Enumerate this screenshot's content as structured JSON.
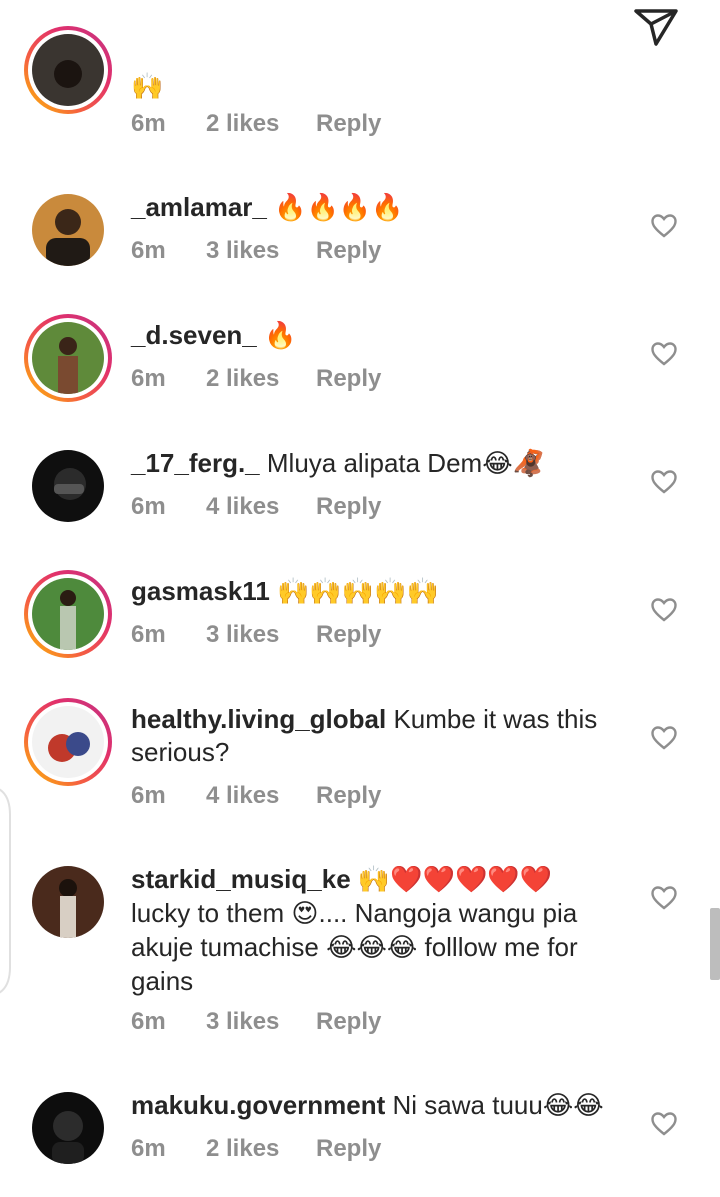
{
  "comments": [
    {
      "username": "",
      "text": "",
      "emoji": "🙌",
      "time": "6m",
      "likes": "2 likes",
      "reply": "Reply"
    },
    {
      "username": "_amlamar_",
      "text": "",
      "emoji": "🔥🔥🔥🔥",
      "time": "6m",
      "likes": "3 likes",
      "reply": "Reply"
    },
    {
      "username": "_d.seven_",
      "text": "",
      "emoji": "🔥",
      "time": "6m",
      "likes": "2 likes",
      "reply": "Reply"
    },
    {
      "username": "_17_ferg._",
      "text": "Mluya alipata Dem",
      "emoji": "😂🦧",
      "time": "6m",
      "likes": "4 likes",
      "reply": "Reply"
    },
    {
      "username": "gasmask11",
      "text": "",
      "emoji": "🙌🙌🙌🙌🙌",
      "time": "6m",
      "likes": "3 likes",
      "reply": "Reply"
    },
    {
      "username": "healthy.living_global",
      "text": "Kumbe it was this serious?",
      "emoji": "",
      "time": "6m",
      "likes": "4 likes",
      "reply": "Reply"
    },
    {
      "username": "starkid_musiq_ke",
      "emoji": "🙌❤️❤️❤️❤️❤️",
      "text_a": "lucky to them ",
      "emoji_b": "😍",
      "text_b": ".... Nangoja wangu pia akuje tumachise ",
      "emoji_c": "😂😂😂",
      "text_c": " folllow me for gains",
      "time": "6m",
      "likes": "3 likes",
      "reply": "Reply"
    },
    {
      "username": "makuku.government",
      "text": "Ni sawa tuuu",
      "emoji": "😂😂",
      "time": "6m",
      "likes": "2 likes",
      "reply": "Reply"
    }
  ],
  "icons": {
    "send": "send-icon",
    "like": "heart-outline-icon"
  },
  "colors": {
    "username": "#262626",
    "meta": "#8e8e8e",
    "ring_start": "#fdc200",
    "ring_end": "#c13584"
  }
}
